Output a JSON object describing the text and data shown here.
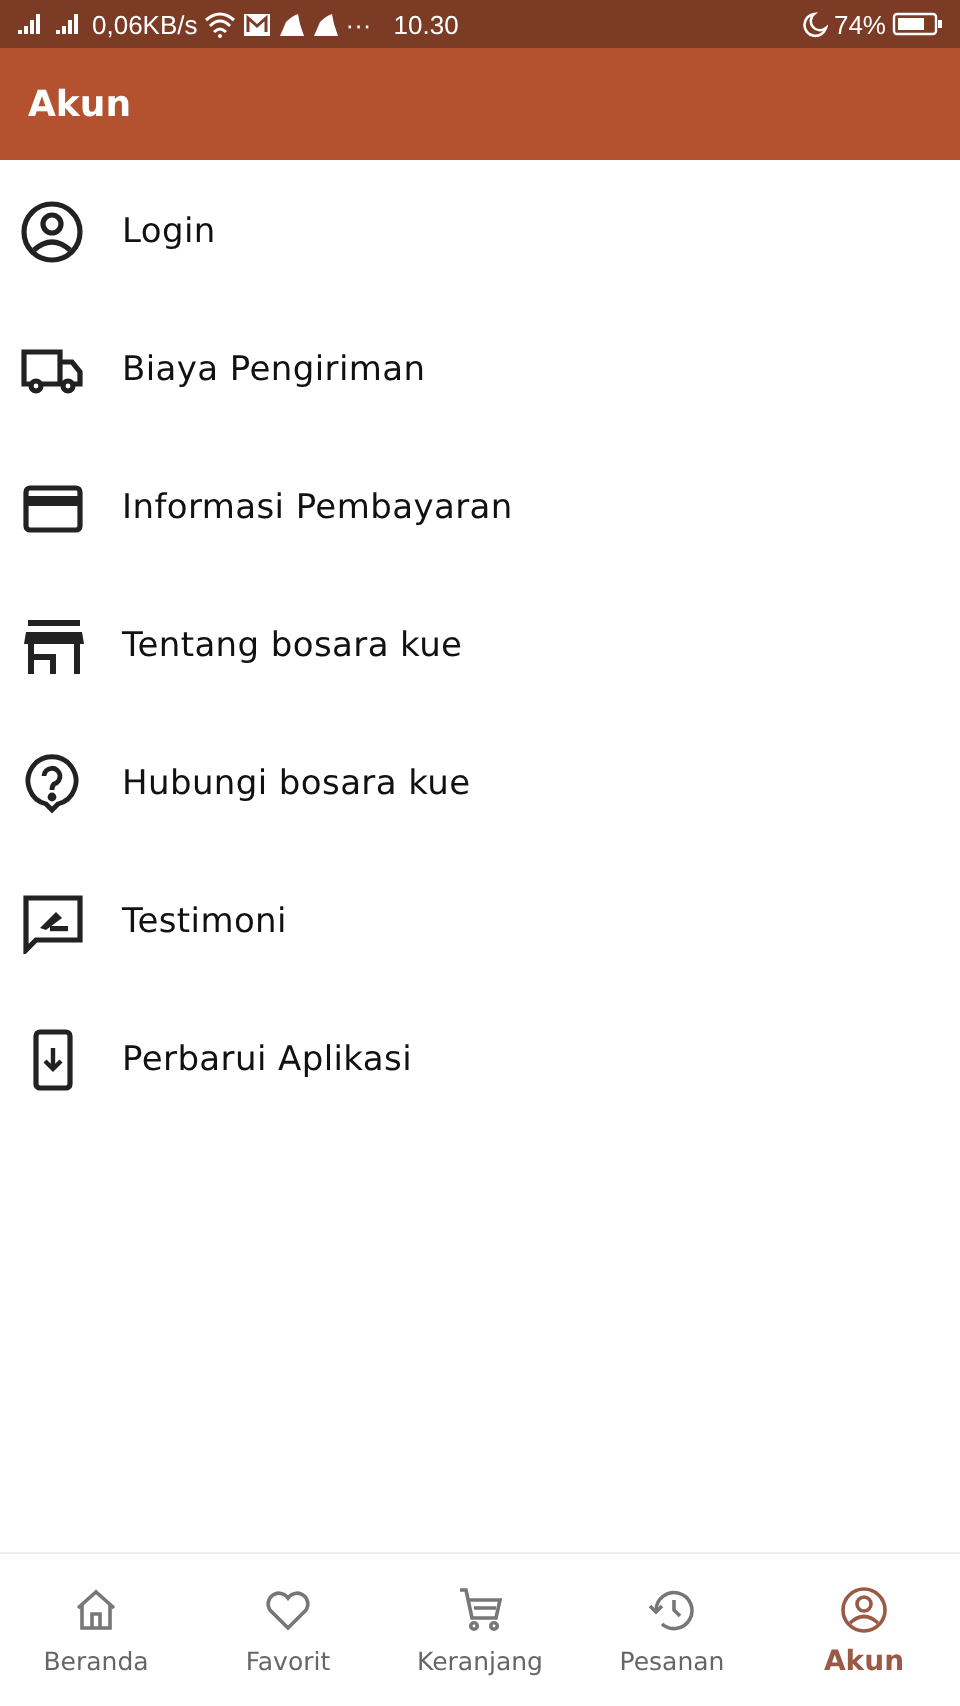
{
  "status_bar": {
    "speed": "0,06KB/s",
    "more": "···",
    "time": "10.30",
    "battery": "74%"
  },
  "app_bar": {
    "title": "Akun"
  },
  "menu": [
    {
      "kind": "user",
      "label": "Login"
    },
    {
      "kind": "truck",
      "label": "Biaya Pengiriman"
    },
    {
      "kind": "card",
      "label": "Informasi Pembayaran"
    },
    {
      "kind": "store",
      "label": "Tentang bosara kue"
    },
    {
      "kind": "help",
      "label": "Hubungi bosara kue"
    },
    {
      "kind": "review",
      "label": "Testimoni"
    },
    {
      "kind": "update",
      "label": "Perbarui Aplikasi"
    }
  ],
  "bottom_nav": [
    {
      "kind": "home",
      "label": "Beranda",
      "selected": false
    },
    {
      "kind": "heart",
      "label": "Favorit",
      "selected": false
    },
    {
      "kind": "cart",
      "label": "Keranjang",
      "selected": false
    },
    {
      "kind": "history",
      "label": "Pesanan",
      "selected": false
    },
    {
      "kind": "user",
      "label": "Akun",
      "selected": true
    }
  ]
}
